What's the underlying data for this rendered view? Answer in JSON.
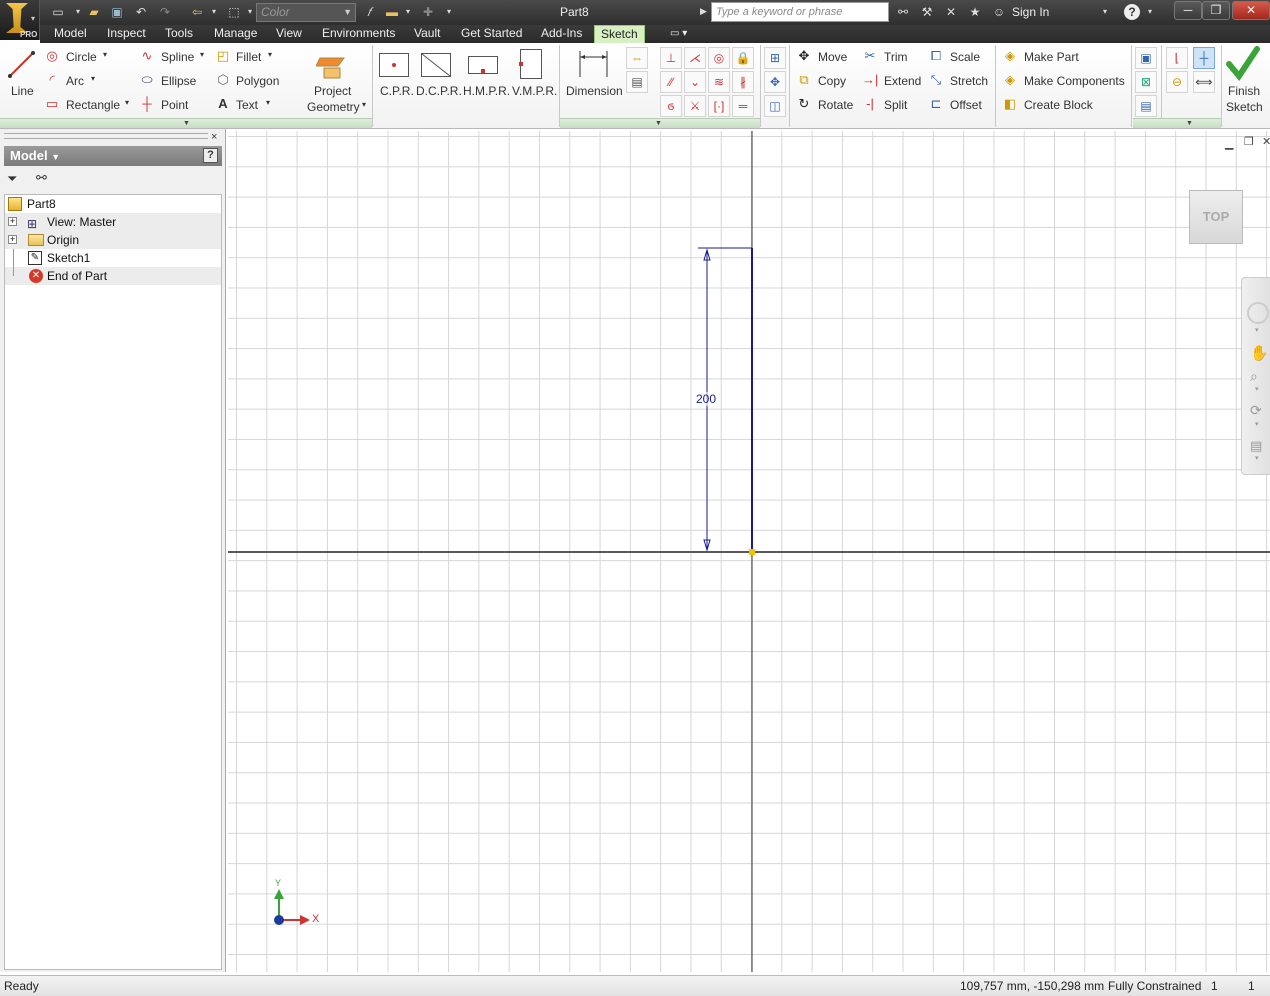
{
  "app": {
    "title": "Part8",
    "edition": "PRO"
  },
  "quick_access": {
    "color_placeholder": "Color",
    "search_placeholder": "Type a keyword or phrase",
    "sign_in": "Sign In"
  },
  "menu_tabs": [
    "Model",
    "Inspect",
    "Tools",
    "Manage",
    "View",
    "Environments",
    "Vault",
    "Get Started",
    "Add-Ins",
    "Sketch"
  ],
  "active_tab": "Sketch",
  "ribbon": {
    "draw": {
      "line": "Line",
      "circle": "Circle",
      "arc": "Arc",
      "rectangle": "Rectangle",
      "spline": "Spline",
      "ellipse": "Ellipse",
      "point": "Point",
      "fillet": "Fillet",
      "polygon": "Polygon",
      "text": "Text",
      "project_geometry_1": "Project",
      "project_geometry_2": "Geometry"
    },
    "rect_tools": [
      "C.P.R.",
      "D.C.P.R.",
      "H.M.P.R.",
      "V.M.P.R."
    ],
    "dimension": "Dimension",
    "modify": {
      "move": "Move",
      "copy": "Copy",
      "rotate": "Rotate",
      "trim": "Trim",
      "extend": "Extend",
      "split": "Split",
      "scale": "Scale",
      "stretch": "Stretch",
      "offset": "Offset"
    },
    "layout": {
      "make_part": "Make Part",
      "make_components": "Make Components",
      "create_block": "Create Block"
    },
    "finish": {
      "line1": "Finish",
      "line2": "Sketch"
    }
  },
  "browser": {
    "header": "Model",
    "tree": [
      {
        "label": "Part8",
        "icon": "part-icon"
      },
      {
        "label": "View: Master",
        "icon": "view-icon"
      },
      {
        "label": "Origin",
        "icon": "folder-icon"
      },
      {
        "label": "Sketch1",
        "icon": "sketch-icon"
      },
      {
        "label": "End of Part",
        "icon": "end-of-part-icon"
      }
    ]
  },
  "viewport": {
    "viewcube_face": "TOP",
    "dimension_value": "200",
    "axis_x": "X",
    "axis_y": "Y"
  },
  "status": {
    "left": "Ready",
    "coords": "109,757 mm, -150,298 mm",
    "constraint": "Fully Constrained",
    "count1": "1",
    "count2": "1"
  },
  "colors": {
    "ribbon_active_tab": "#d6f0c4",
    "sketch_line": "#1a1a8c",
    "grid": "#d6d6d6"
  }
}
